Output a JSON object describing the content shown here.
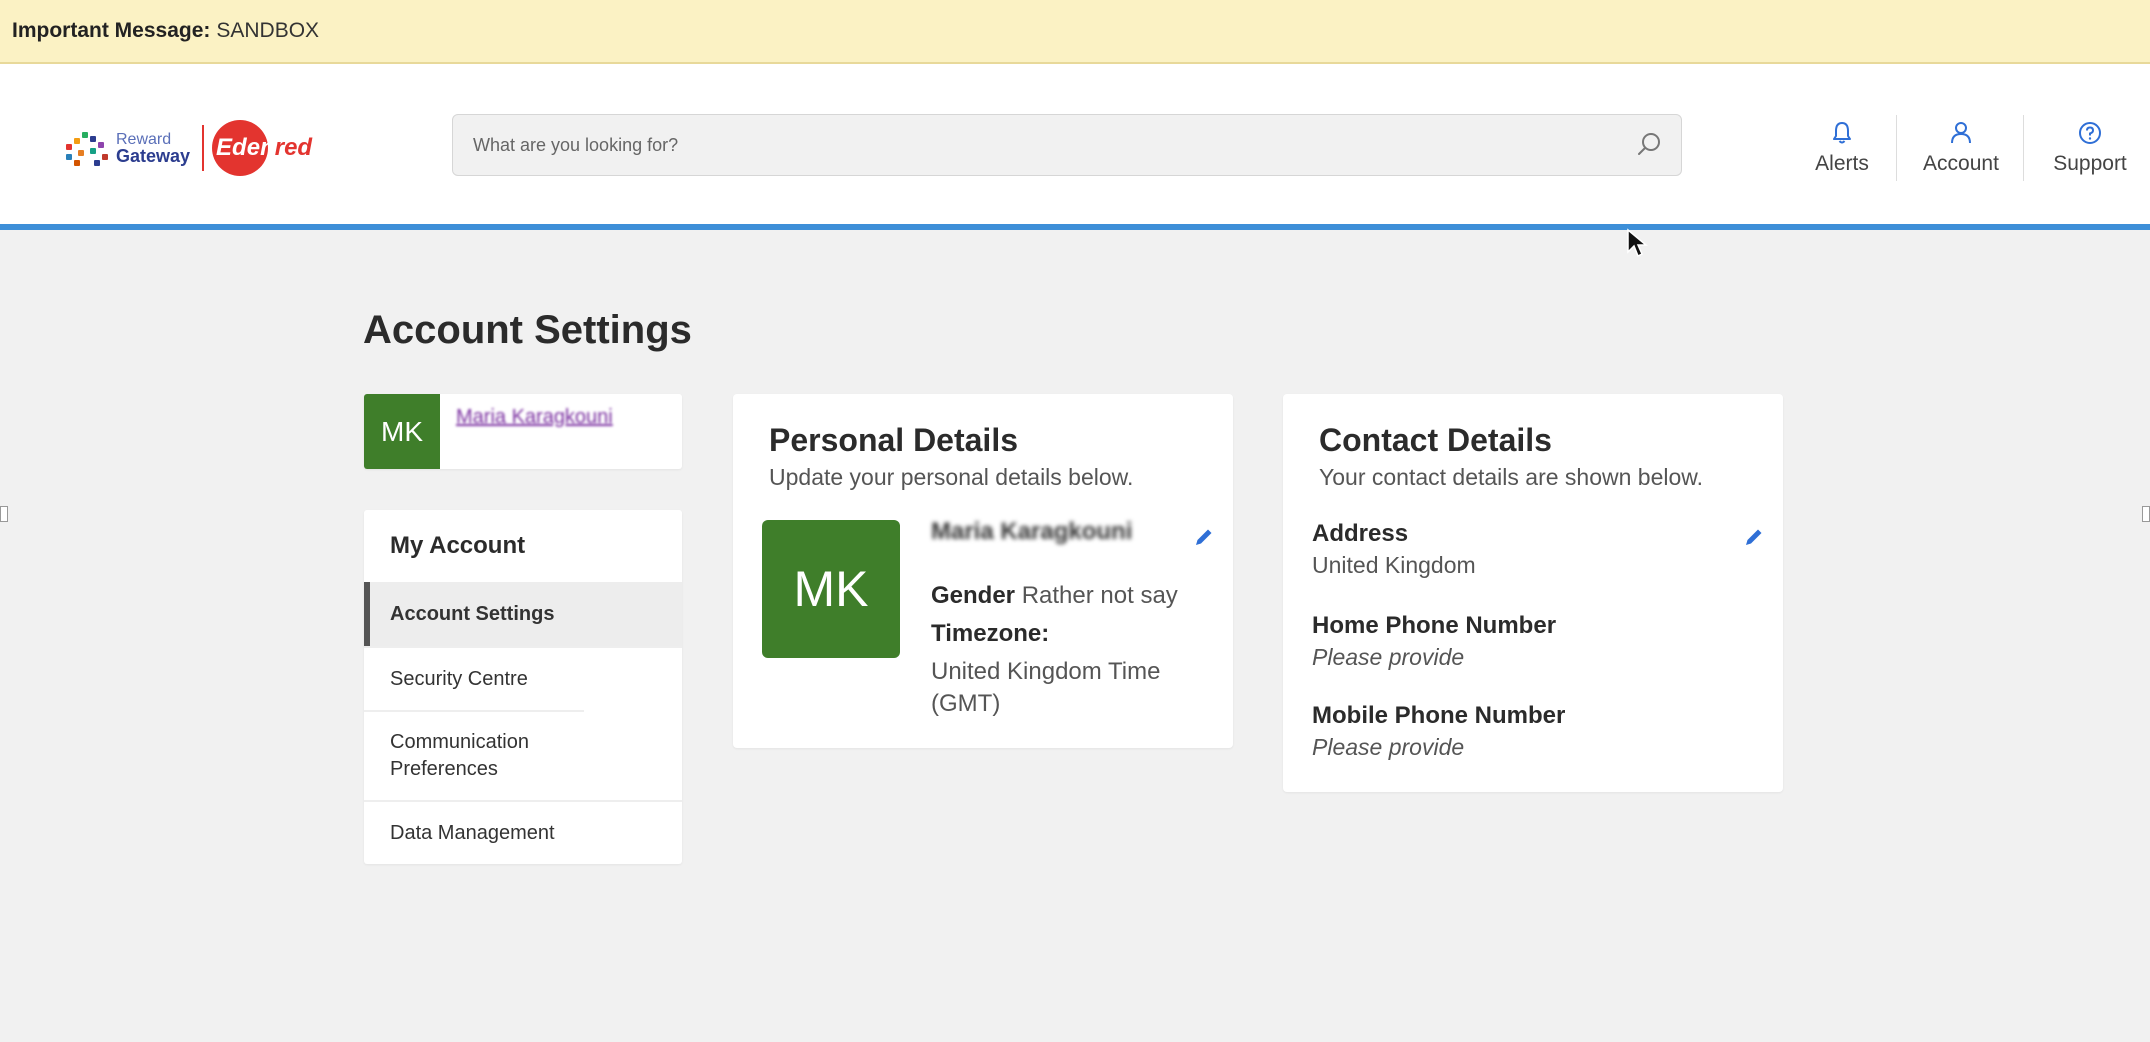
{
  "banner": {
    "label": "Important Message:",
    "text": "SANDBOX"
  },
  "logo": {
    "line1": "Reward",
    "line2": "Gateway",
    "brand_a": "Eden",
    "brand_b": "red"
  },
  "search": {
    "placeholder": "What are you looking for?"
  },
  "nav": {
    "items": [
      {
        "label": "Alerts",
        "icon": "bell-icon"
      },
      {
        "label": "Account",
        "icon": "user-icon"
      },
      {
        "label": "Support",
        "icon": "help-circle-icon"
      }
    ]
  },
  "page": {
    "title": "Account Settings"
  },
  "user": {
    "initials": "MK",
    "name": "Maria Karagkouni"
  },
  "menu": {
    "heading": "My Account",
    "items": [
      {
        "label": "Account Settings",
        "active": true
      },
      {
        "label": "Security Centre"
      },
      {
        "label": "Communication Preferences"
      },
      {
        "label": "Data Management"
      }
    ]
  },
  "personal": {
    "title": "Personal Details",
    "subtitle": "Update your personal details below.",
    "initials": "MK",
    "name": "Maria Karagkouni",
    "gender_label": "Gender",
    "gender_value": "Rather not say",
    "timezone_label": "Timezone:",
    "timezone_value_1": "United Kingdom Time",
    "timezone_value_2": "(GMT)"
  },
  "contact": {
    "title": "Contact Details",
    "subtitle": "Your contact details are shown below.",
    "address_label": "Address",
    "address_value": "United Kingdom",
    "home_label": "Home Phone Number",
    "home_value": "Please provide",
    "mobile_label": "Mobile Phone Number",
    "mobile_value": "Please provide"
  },
  "colors": {
    "banner_bg": "#fbf2c4",
    "accent_blue": "#3d8fd8",
    "avatar_green": "#3f7e2a",
    "brand_red": "#e3342f",
    "edit_blue": "#2f6fd6"
  }
}
